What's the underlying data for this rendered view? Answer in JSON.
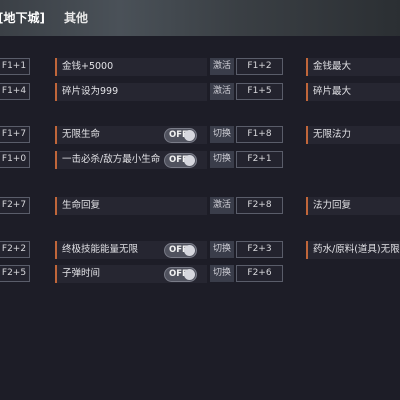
{
  "tabs": [
    "[地下城]",
    "其他"
  ],
  "rows": [
    {
      "left_key": "F1+1",
      "label": "金钱+5000",
      "mode": "激活",
      "key": "F1+2",
      "right": "金钱最大"
    },
    {
      "left_key": "F1+4",
      "label": "碎片设为999",
      "mode": "激活",
      "key": "F1+5",
      "right": "碎片最大"
    },
    {
      "left_key": "F1+7",
      "label": "无限生命",
      "toggle": "OFF",
      "mode": "切换",
      "key": "F1+8",
      "right": "无限法力"
    },
    {
      "left_key": "F1+0",
      "label": "一击必杀/敌方最小生命",
      "toggle": "OFF",
      "mode": "切换",
      "key": "F2+1",
      "right": ""
    },
    {
      "left_key": "F2+7",
      "label": "生命回复",
      "mode": "激活",
      "key": "F2+8",
      "right": "法力回复"
    },
    {
      "left_key": "F2+2",
      "label": "终极技能能量无限",
      "toggle": "OFF",
      "mode": "切换",
      "key": "F2+3",
      "right": "药水/原料(道具)无限"
    },
    {
      "left_key": "F2+5",
      "label": "子弹时间",
      "toggle": "OFF",
      "mode": "切换",
      "key": "F2+6",
      "right": ""
    }
  ]
}
